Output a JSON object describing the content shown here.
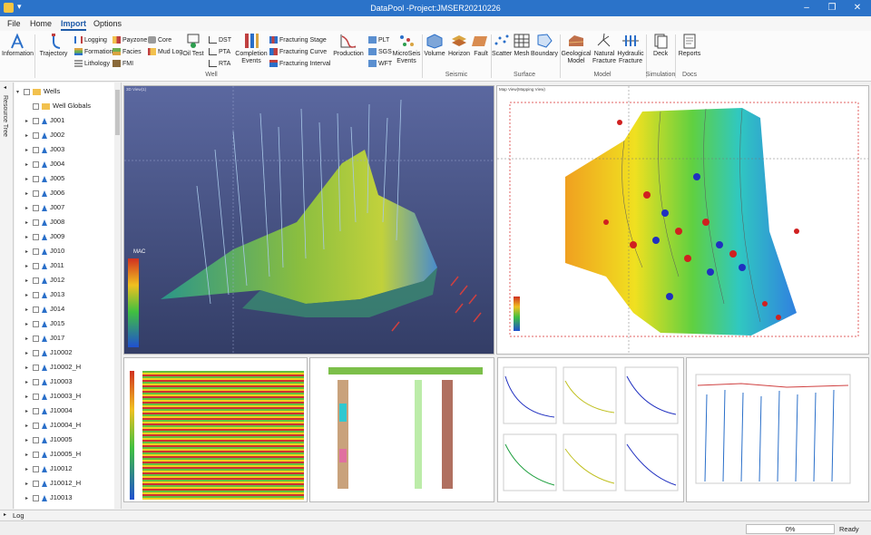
{
  "window": {
    "title": "DataPool -Project:JMSER20210226"
  },
  "menu": {
    "tabs": [
      "File",
      "Home",
      "Import",
      "Options"
    ],
    "active": "Import"
  },
  "ribbon": {
    "information": "Information",
    "trajectory": "Trajectory",
    "logging": "Logging",
    "formation": "Formation",
    "lithology": "Lithology",
    "payzone": "Payzone",
    "facies": "Facies",
    "fmi": "FMI",
    "core": "Core",
    "mudlog": "Mud Log",
    "oiltest": "Oil Test",
    "dst": "DST",
    "pta": "PTA",
    "rta": "RTA",
    "completion": "Completion Events",
    "frac_stage": "Fracturing Stage",
    "frac_curve": "Fracturing Curve",
    "frac_interval": "Fracturing Interval",
    "production": "Production",
    "plt": "PLT",
    "sgs": "SGS",
    "wft": "WFT",
    "microseis": "MicroSeis Events",
    "volume": "Volume",
    "horizon": "Horizon",
    "fault": "Fault",
    "scatter": "Scatter",
    "mesh": "Mesh",
    "boundary": "Boundary",
    "geomodel": "Geological Model",
    "natfrac": "Natural Fracture",
    "hydfrac": "Hydraulic Fracture",
    "deck": "Deck",
    "reports": "Reports",
    "groups": {
      "well": "Well",
      "seismic": "Seismic",
      "surface": "Surface",
      "model": "Model",
      "simulation": "Simulation",
      "docs": "Docs"
    }
  },
  "sidebar": {
    "label": "Resource Tree"
  },
  "tree": {
    "root": "Wells",
    "items": [
      "Well Globals",
      "J001",
      "J002",
      "J003",
      "J004",
      "J005",
      "J006",
      "J007",
      "J008",
      "J009",
      "J010",
      "J011",
      "J012",
      "J013",
      "J014",
      "J015",
      "J017",
      "J10002",
      "J10002_H",
      "J10003",
      "J10003_H",
      "J10004",
      "J10004_H",
      "J10005",
      "J10005_H",
      "J10012",
      "J10012_H",
      "J10013"
    ]
  },
  "panels": {
    "view3d": {
      "title": "3D View(1)",
      "legend_title": "MAC"
    },
    "map": {
      "title": "Map View(Mapping View)"
    }
  },
  "log": {
    "label": "Log"
  },
  "status": {
    "progress": "0%",
    "text": "Ready"
  },
  "colors": {
    "titlebar": "#2b73c9",
    "accent": "#1d5aa8"
  }
}
